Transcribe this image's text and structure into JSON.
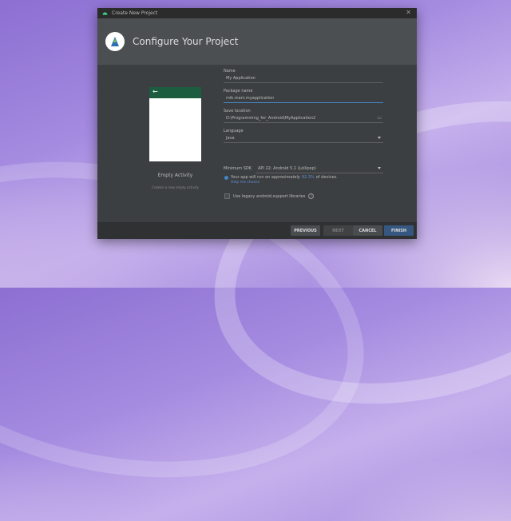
{
  "window": {
    "title": "Create New Project"
  },
  "header": {
    "title": "Configure Your Project"
  },
  "preview": {
    "activity_name": "Empty Activity",
    "activity_desc": "Creates a new empty activity"
  },
  "form": {
    "name_label": "Name",
    "name_value": "My Application",
    "package_label": "Package name",
    "package_value": "mik.mani.myapplication",
    "save_label": "Save location",
    "save_value": "D:\\Programming_for_Android\\MyApplication2",
    "language_label": "Language",
    "language_value": "Java",
    "sdk_label": "Minimum SDK",
    "sdk_value": "API 22: Android 5.1 (Lollipop)",
    "info_prefix": "Your app will run on approximately",
    "info_percent": "92.3%",
    "info_suffix": "of devices.",
    "help_link": "Help me choose",
    "legacy_label": "Use legacy android.support libraries"
  },
  "footer": {
    "previous": "PREVIOUS",
    "next": "NEXT",
    "cancel": "CANCEL",
    "finish": "FINISH"
  },
  "colors": {
    "accent": "#4a88c7",
    "finish_button": "#365880",
    "preview_toolbar": "#1c5c3f"
  }
}
